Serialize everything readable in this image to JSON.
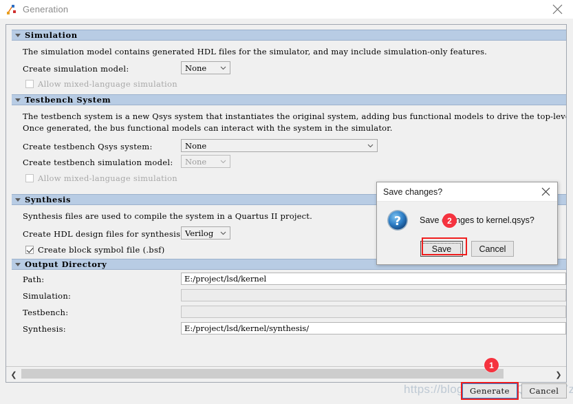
{
  "window": {
    "title": "Generation",
    "icon": "qsys-app-icon",
    "close_label": "close-icon"
  },
  "sections": {
    "simulation": {
      "title": "Simulation",
      "description": "The simulation model contains generated HDL files for the simulator, and may include simulation-only features.",
      "create_model_label": "Create simulation model:",
      "create_model_value": "None",
      "mixed_language_label": "Allow mixed-language simulation",
      "mixed_language_checked": false
    },
    "testbench": {
      "title": "Testbench System",
      "description_line1": "The testbench system is a new Qsys system that instantiates the original system, adding bus functional models to drive the top-level i",
      "description_line2": "Once generated, the bus functional models can interact with the system in the simulator.",
      "qsys_system_label": "Create testbench Qsys system:",
      "qsys_system_value": "None",
      "sim_model_label": "Create testbench simulation model:",
      "sim_model_value": "None",
      "mixed_language_label": "Allow mixed-language simulation",
      "mixed_language_checked": false
    },
    "synthesis": {
      "title": "Synthesis",
      "description": "Synthesis files are used to compile the system in a Quartus II project.",
      "hdl_label": "Create HDL design files for synthesis:",
      "hdl_value": "Verilog",
      "bsf_label": "Create block symbol file (.bsf)",
      "bsf_checked": true
    },
    "output_directory": {
      "title": "Output Directory",
      "rows": [
        {
          "label": "Path:",
          "value": "E:/project/lsd/kernel",
          "readonly": false
        },
        {
          "label": "Simulation:",
          "value": "",
          "readonly": true
        },
        {
          "label": "Testbench:",
          "value": "",
          "readonly": true
        },
        {
          "label": "Synthesis:",
          "value": "E:/project/lsd/kernel/synthesis/",
          "readonly": false
        }
      ]
    }
  },
  "scrollbar": {
    "left_arrow": "❮",
    "right_arrow": "❯"
  },
  "footer": {
    "generate_label": "Generate",
    "cancel_label": "Cancel"
  },
  "dialog": {
    "title": "Save changes?",
    "icon": "question-icon",
    "message": "Save changes to kernel.qsys?",
    "save_label": "Save",
    "cancel_label": "Cancel",
    "close_label": "close-icon"
  },
  "annotations": {
    "badge1": "1",
    "badge2": "2"
  },
  "watermark": {
    "text": "https://blog.csdn.net/QWERTYzxw"
  },
  "colors": {
    "section_header": "#b8cce4",
    "accent_red": "#f5333f",
    "focus_blue": "#2f7fd1"
  }
}
